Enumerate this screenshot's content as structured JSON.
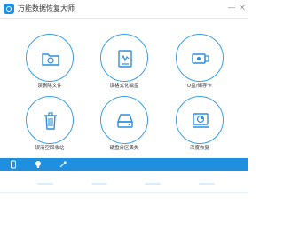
{
  "window": {
    "title": "万能数据恢复大师",
    "minimize_label": "—",
    "close_label": "×"
  },
  "tiles": [
    {
      "label": "误删除文件",
      "icon": "folder-recycle-icon"
    },
    {
      "label": "误格式化磁盘",
      "icon": "disk-format-icon"
    },
    {
      "label": "U盘/储存卡",
      "icon": "usb-card-icon"
    },
    {
      "label": "误清空回收站",
      "icon": "recycle-bin-icon"
    },
    {
      "label": "硬盘分区丢失",
      "icon": "hard-drive-icon"
    },
    {
      "label": "深度恢复",
      "icon": "deep-scan-icon"
    }
  ],
  "colors": {
    "accent": "#1f8fe0",
    "circle_border": "#3aa0ea"
  },
  "bottom_bar": {
    "icons": [
      "phone-icon",
      "lightbulb-icon",
      "feedback-icon"
    ]
  }
}
